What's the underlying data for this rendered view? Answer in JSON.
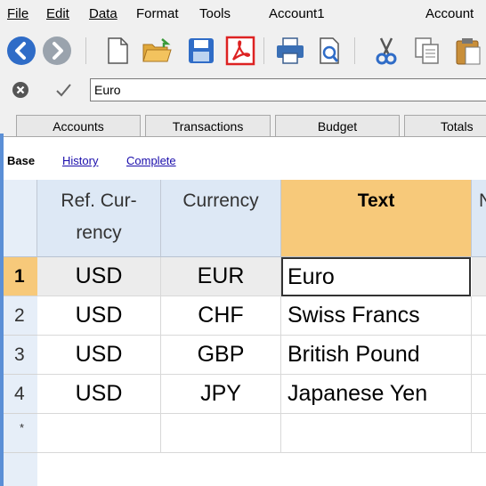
{
  "menu": {
    "items": [
      {
        "label": "File"
      },
      {
        "label": "Edit"
      },
      {
        "label": "Data"
      },
      {
        "label": "Format"
      },
      {
        "label": "Tools"
      },
      {
        "label": "Account1"
      },
      {
        "label": "Account"
      }
    ]
  },
  "toolbar": {
    "icons": [
      "back-icon",
      "forward-icon",
      "new-file-icon",
      "open-folder-icon",
      "save-icon",
      "pdf-icon",
      "print-icon",
      "print-preview-icon",
      "cut-icon",
      "copy-icon",
      "paste-icon"
    ]
  },
  "formula_bar": {
    "value": "Euro"
  },
  "tabs": [
    {
      "label": "Accounts"
    },
    {
      "label": "Transactions"
    },
    {
      "label": "Budget"
    },
    {
      "label": "Totals"
    }
  ],
  "views": [
    {
      "label": "Base",
      "active": true
    },
    {
      "label": "History",
      "active": false
    },
    {
      "label": "Complete",
      "active": false
    }
  ],
  "table": {
    "columns": [
      {
        "label": "Ref. Cur-",
        "label2": "rency"
      },
      {
        "label": "Currency"
      },
      {
        "label": "Text"
      },
      {
        "label": "N"
      }
    ],
    "rows": [
      {
        "num": "1",
        "ref": "USD",
        "currency": "EUR",
        "text": "Euro"
      },
      {
        "num": "2",
        "ref": "USD",
        "currency": "CHF",
        "text": "Swiss Francs"
      },
      {
        "num": "3",
        "ref": "USD",
        "currency": "GBP",
        "text": "British Pound"
      },
      {
        "num": "4",
        "ref": "USD",
        "currency": "JPY",
        "text": "Japanese Yen"
      }
    ],
    "new_row_marker": "*"
  },
  "colors": {
    "selection_header": "#f7c97a",
    "header_bg": "#dde8f5",
    "link": "#1a0dab"
  }
}
